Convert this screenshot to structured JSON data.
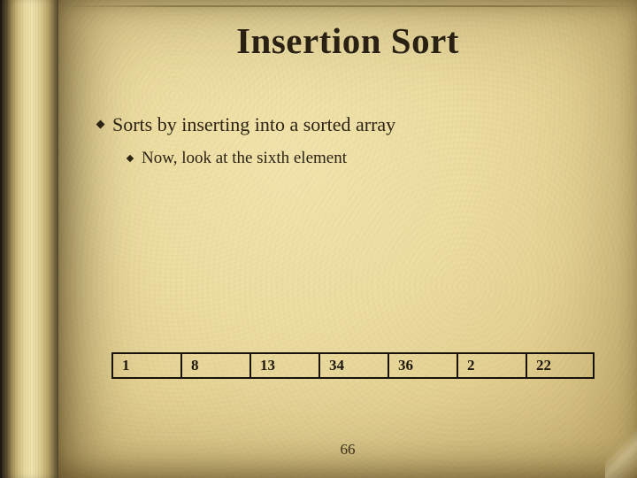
{
  "title": "Insertion Sort",
  "bullet_main": "Sorts by inserting into a sorted array",
  "bullet_sub": "Now, look at the sixth element",
  "array_cells": [
    "1",
    "8",
    "13",
    "34",
    "36",
    "2",
    "22"
  ],
  "page_number": "66"
}
